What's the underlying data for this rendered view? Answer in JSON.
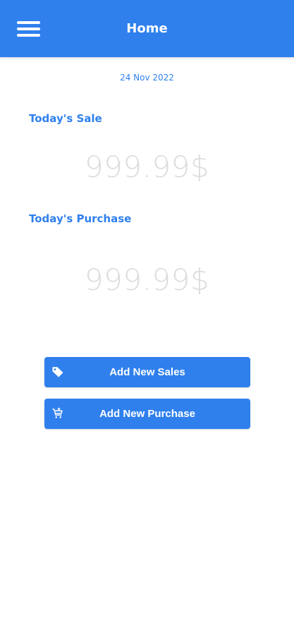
{
  "appbar": {
    "title": "Home",
    "menu_icon": "hamburger-menu-icon",
    "color": "#2f80ed"
  },
  "date": "24 Nov 2022",
  "today_sale": {
    "label": "Today's Sale",
    "amount": "999.99$"
  },
  "today_purchase": {
    "label": "Today's Purchase",
    "amount": "999.99$"
  },
  "actions": {
    "add_sales": {
      "label": "Add New Sales",
      "icon": "tag-icon"
    },
    "add_purchase": {
      "label": "Add New Purchase",
      "icon": "add-cart-icon"
    }
  },
  "colors": {
    "accent": "#2f80ed",
    "amount_text": "#dcdcdc",
    "background": "#ffffff"
  }
}
